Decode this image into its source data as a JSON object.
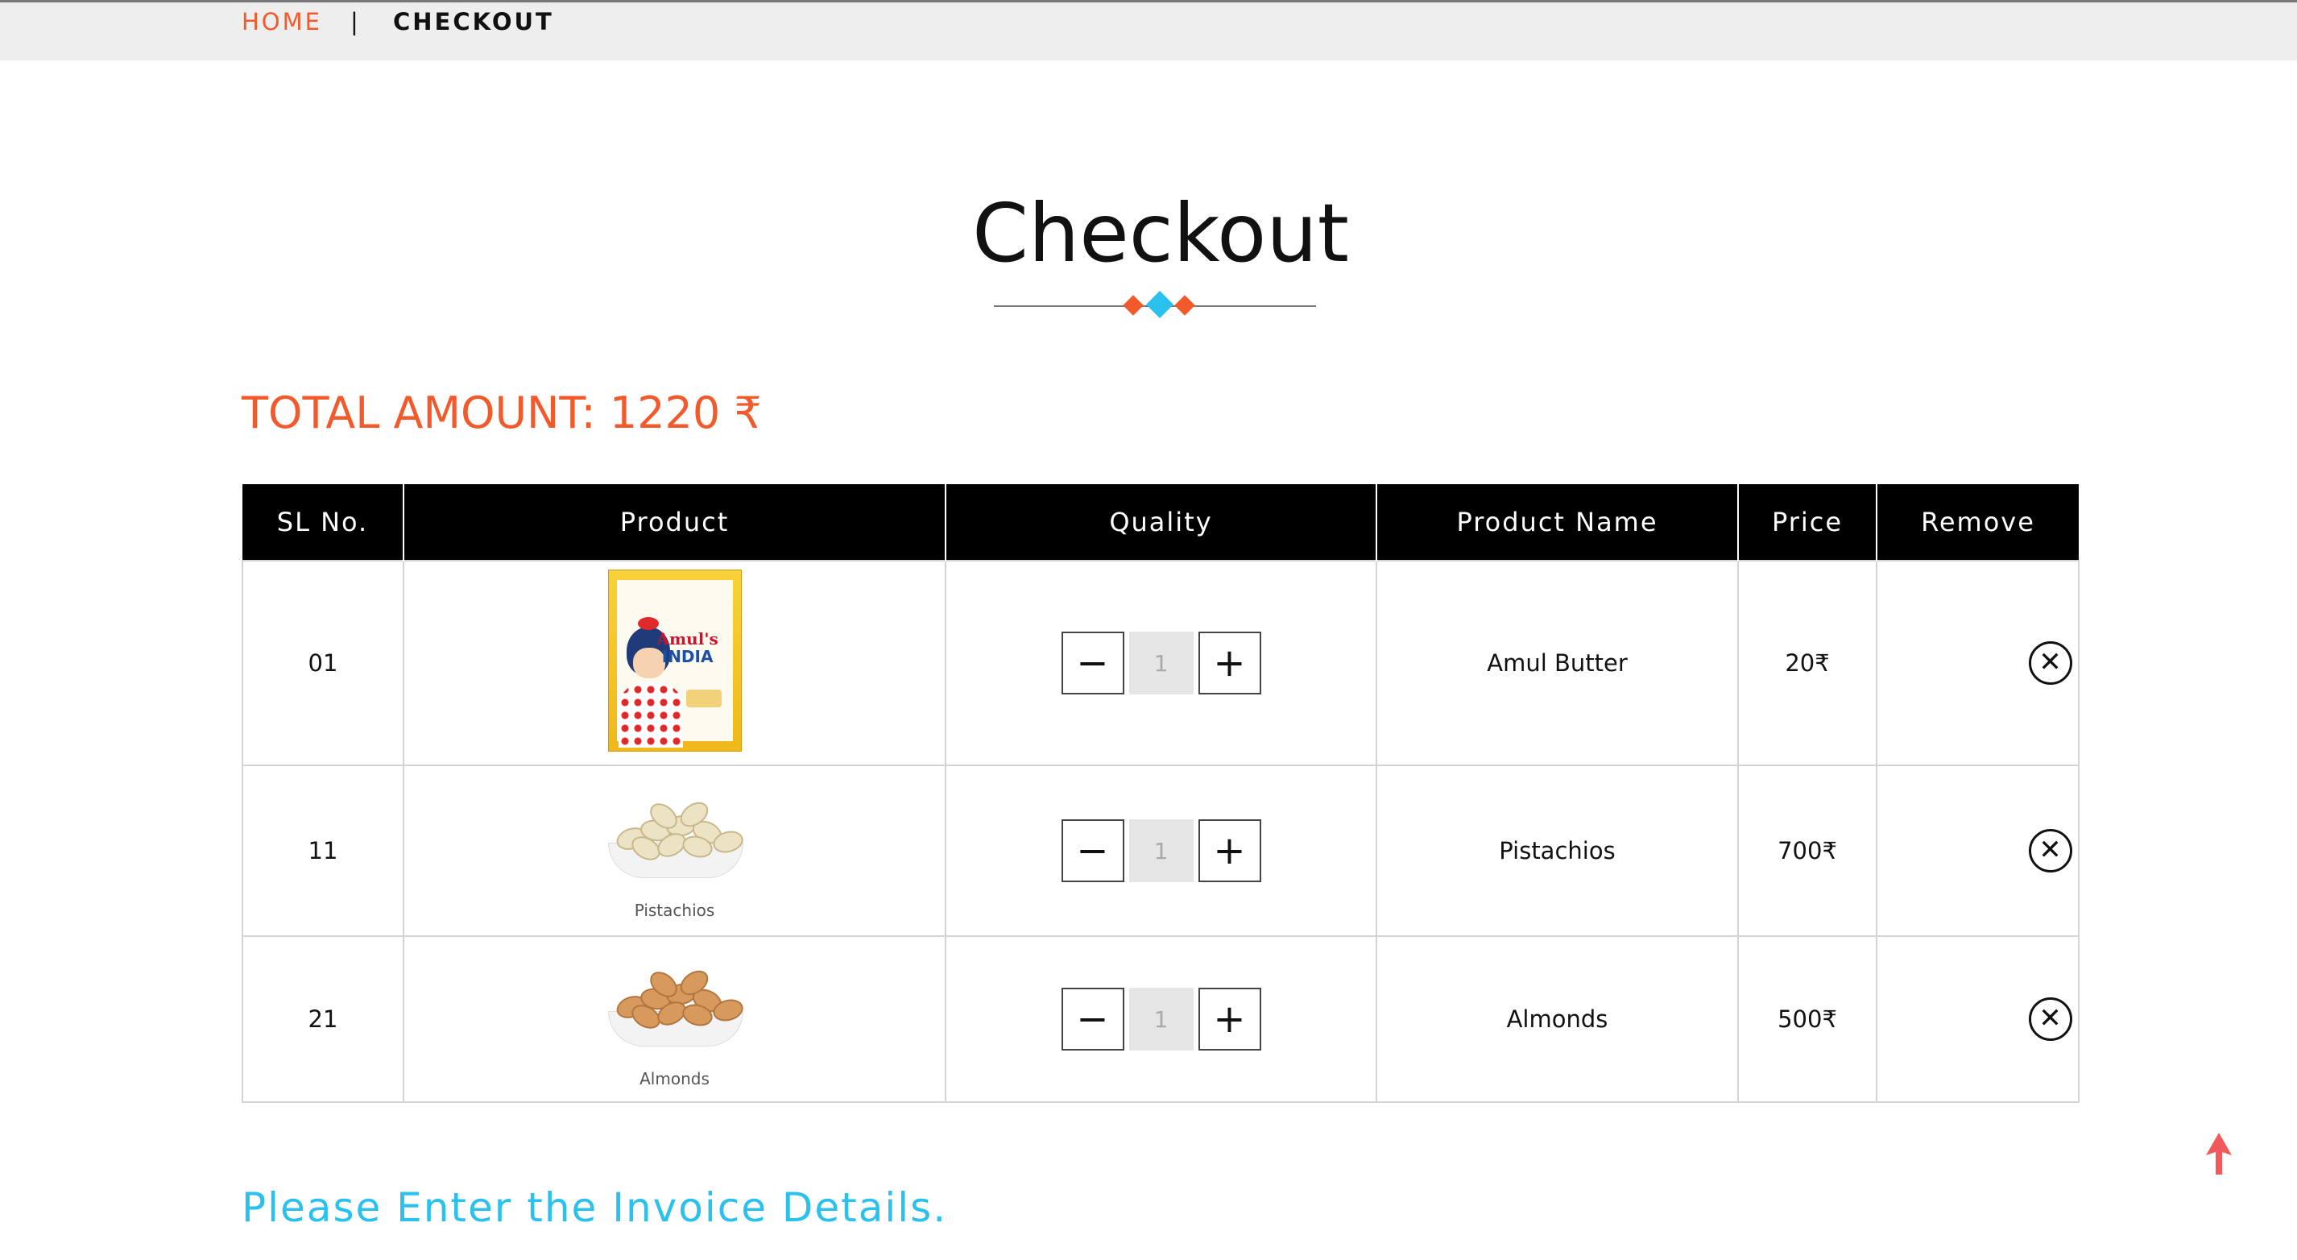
{
  "breadcrumb": {
    "home": "HOME",
    "separator": "|",
    "current": "CHECKOUT"
  },
  "title": "Checkout",
  "total_amount": "TOTAL AMOUNT: 1220 ₹",
  "table": {
    "headers": [
      "SL No.",
      "Product",
      "Quality",
      "Product Name",
      "Price",
      "Remove"
    ],
    "rows": [
      {
        "sl": "01",
        "product_caption": "",
        "product_logo": "Amul's",
        "product_logo_2": "INDIA",
        "quantity": "1",
        "name": "Amul Butter",
        "price": "20₹"
      },
      {
        "sl": "11",
        "product_caption": "Pistachios",
        "quantity": "1",
        "name": "Pistachios",
        "price": "700₹"
      },
      {
        "sl": "21",
        "product_caption": "Almonds",
        "quantity": "1",
        "name": "Almonds",
        "price": "500₹"
      }
    ]
  },
  "qty_controls": {
    "minus": "−",
    "plus": "+"
  },
  "remove_glyph": "✕",
  "invoice_prompt": "Please Enter the Invoice Details.",
  "colors": {
    "accent_orange": "#f25a2c",
    "accent_blue": "#2bc1ee",
    "header_bg": "#000000",
    "breadcrumb_bg": "#eeeeee"
  },
  "icons": {
    "remove": "close-circle-icon",
    "scroll_top": "arrow-up-icon"
  }
}
